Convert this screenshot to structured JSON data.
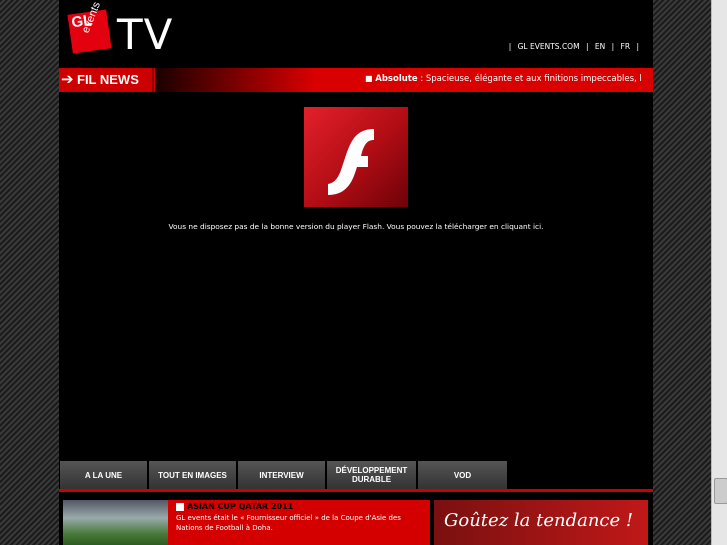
{
  "header": {
    "logo_top": "GL",
    "logo_bottom": "events",
    "tv_label": "TV",
    "links": [
      "|",
      "GL EVENTS.COM",
      "|",
      "EN",
      "|",
      "FR",
      "|"
    ]
  },
  "ticker": {
    "label": "FIL NEWS",
    "arrow": "➔",
    "bullet": "■",
    "headline": "Absolute",
    "text": " : Spacieuse, élégante et aux finitions impeccables, l"
  },
  "player": {
    "message": "Vous ne disposez pas de la bonne version du player Flash. Vous pouvez la télécharger en cliquant ici.",
    "icon": "flash-player-icon"
  },
  "nav": {
    "items": [
      "A LA UNE",
      "TOUT EN IMAGES",
      "INTERVIEW",
      "DÉVELOPPEMENT DURABLE",
      "VOD"
    ]
  },
  "news": {
    "title": "ASIAN CUP QATAR 2011",
    "body": "GL events était le « Fournisseur officiel » de la Coupe d'Asie des Nations de Football à Doha."
  },
  "ad": {
    "text": "Goûtez la tendance !"
  },
  "colors": {
    "accent": "#d90000",
    "background": "#000000"
  }
}
